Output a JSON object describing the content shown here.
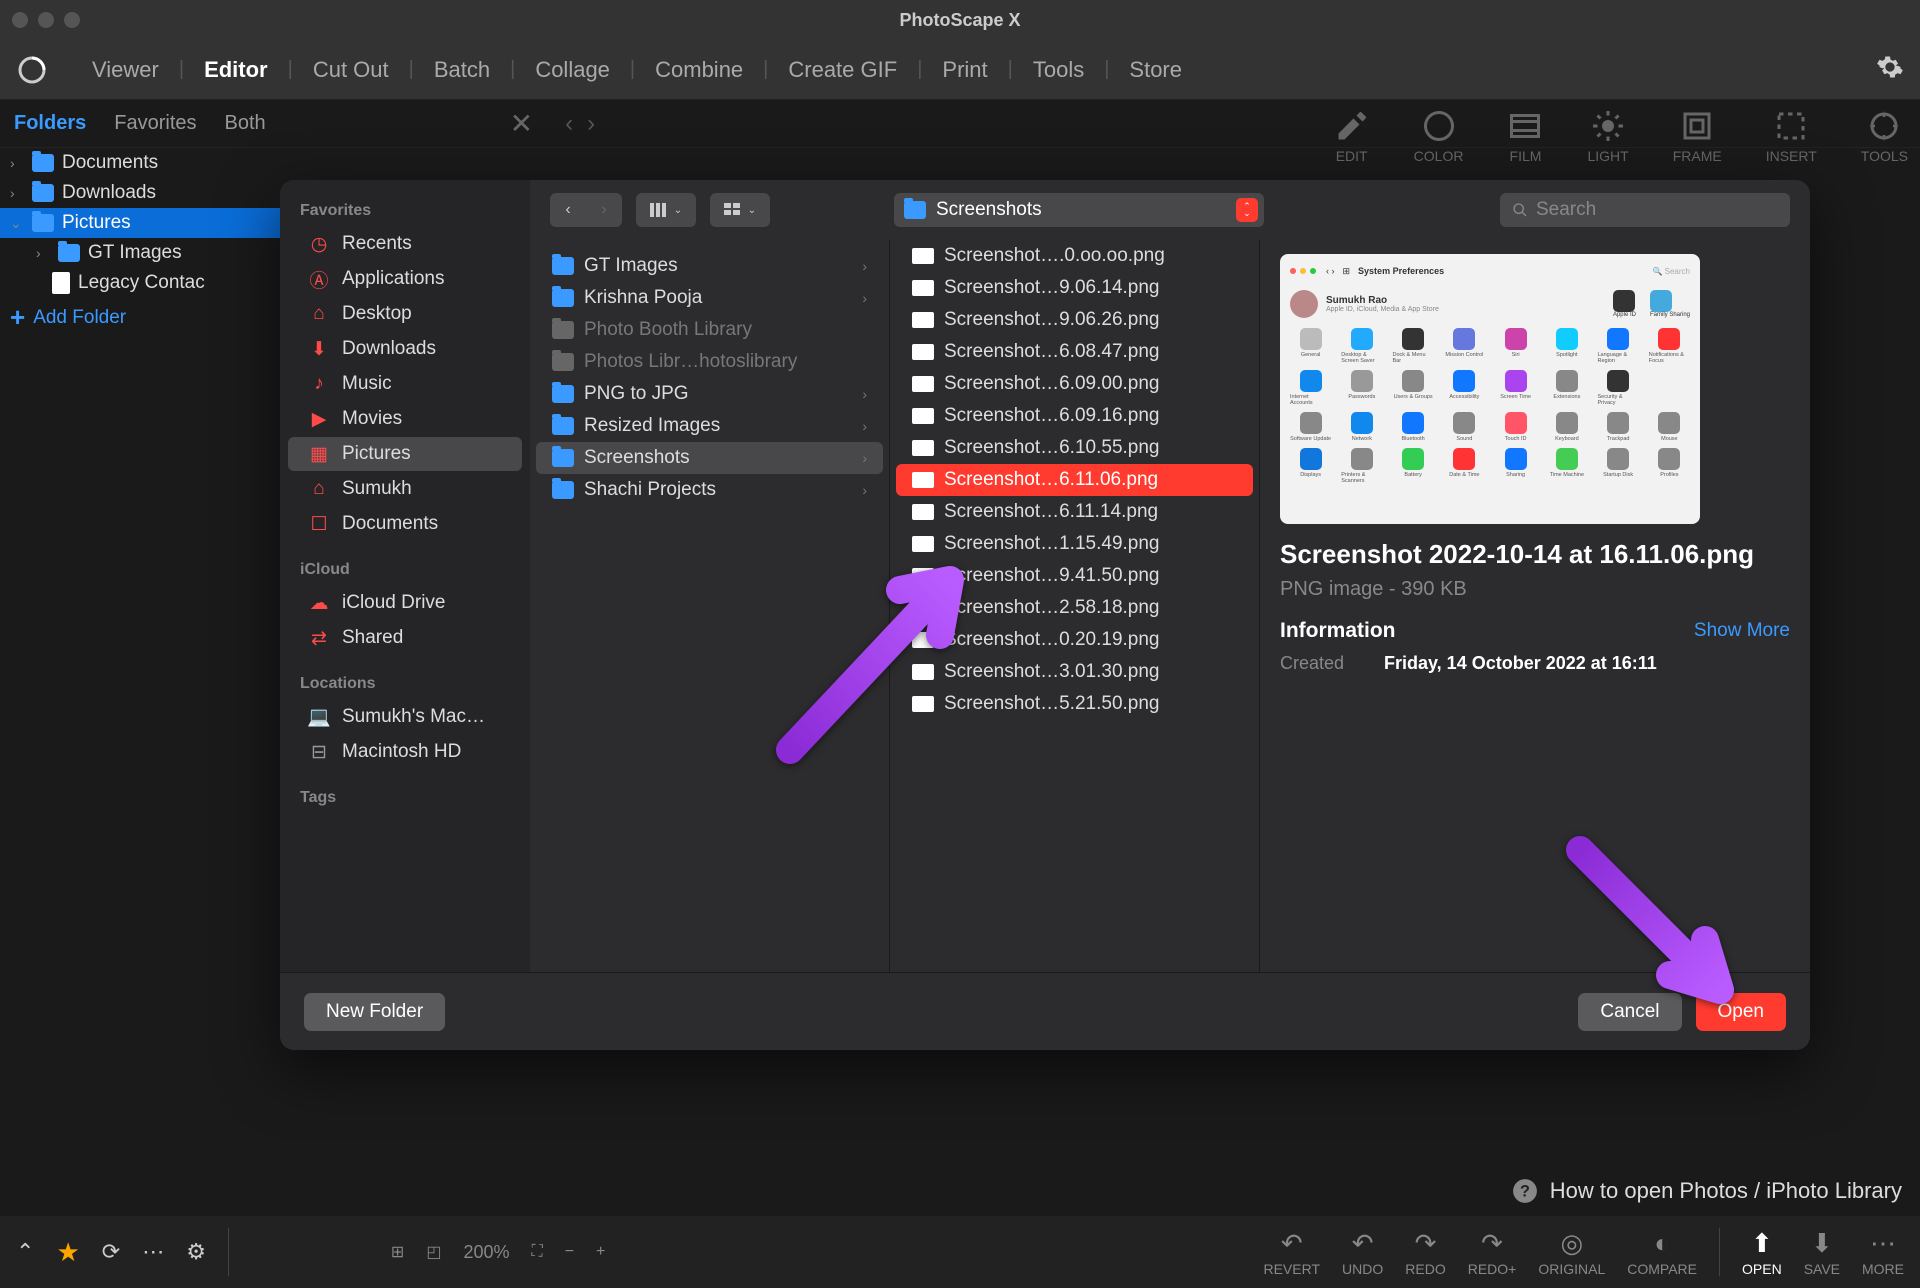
{
  "window": {
    "title": "PhotoScape X"
  },
  "main_tabs": [
    "Viewer",
    "Editor",
    "Cut Out",
    "Batch",
    "Collage",
    "Combine",
    "Create GIF",
    "Print",
    "Tools",
    "Store"
  ],
  "main_tabs_active": "Editor",
  "sec_tabs": [
    "Folders",
    "Favorites",
    "Both"
  ],
  "sec_tabs_active": "Folders",
  "tree": {
    "items": [
      {
        "label": "Documents",
        "indent": 0
      },
      {
        "label": "Downloads",
        "indent": 0
      },
      {
        "label": "Pictures",
        "indent": 0,
        "selected": true,
        "expanded": true
      },
      {
        "label": "GT Images",
        "indent": 1
      },
      {
        "label": "Legacy Contac",
        "indent": 1,
        "file": true
      },
      {
        "label": "Add Folder",
        "indent": 0,
        "add": true
      }
    ]
  },
  "tool_icons": [
    {
      "name": "edit",
      "label": "EDIT"
    },
    {
      "name": "color",
      "label": "COLOR"
    },
    {
      "name": "film",
      "label": "FILM"
    },
    {
      "name": "light",
      "label": "LIGHT"
    },
    {
      "name": "frame",
      "label": "FRAME"
    },
    {
      "name": "insert",
      "label": "INSERT"
    },
    {
      "name": "tools",
      "label": "TOOLS"
    }
  ],
  "dialog": {
    "sidebar": {
      "sections": [
        {
          "heading": "Favorites",
          "items": [
            {
              "icon": "clock",
              "label": "Recents"
            },
            {
              "icon": "apps",
              "label": "Applications"
            },
            {
              "icon": "desktop",
              "label": "Desktop"
            },
            {
              "icon": "download",
              "label": "Downloads"
            },
            {
              "icon": "music",
              "label": "Music"
            },
            {
              "icon": "movie",
              "label": "Movies"
            },
            {
              "icon": "picture",
              "label": "Pictures",
              "selected": true
            },
            {
              "icon": "home",
              "label": "Sumukh"
            },
            {
              "icon": "doc",
              "label": "Documents"
            }
          ]
        },
        {
          "heading": "iCloud",
          "items": [
            {
              "icon": "cloud",
              "label": "iCloud Drive"
            },
            {
              "icon": "shared",
              "label": "Shared"
            }
          ]
        },
        {
          "heading": "Locations",
          "items": [
            {
              "icon": "laptop",
              "label": "Sumukh's Mac…",
              "gray": true
            },
            {
              "icon": "disk",
              "label": "Macintosh HD",
              "gray": true
            }
          ]
        },
        {
          "heading": "Tags",
          "items": []
        }
      ]
    },
    "path_label": "Screenshots",
    "search_placeholder": "Search",
    "column1": [
      {
        "label": "GT Images",
        "type": "folder"
      },
      {
        "label": "Krishna Pooja",
        "type": "folder"
      },
      {
        "label": "Photo Booth Library",
        "type": "lib",
        "disabled": true
      },
      {
        "label": "Photos Libr…hotoslibrary",
        "type": "lib",
        "disabled": true
      },
      {
        "label": "PNG to JPG",
        "type": "folder"
      },
      {
        "label": "Resized Images",
        "type": "folder"
      },
      {
        "label": "Screenshots",
        "type": "folder",
        "selected": true
      },
      {
        "label": "Shachi Projects",
        "type": "folder"
      }
    ],
    "column2": [
      {
        "label": "Screenshot….0.oo.oo.png"
      },
      {
        "label": "Screenshot…9.06.14.png"
      },
      {
        "label": "Screenshot…9.06.26.png"
      },
      {
        "label": "Screenshot…6.08.47.png"
      },
      {
        "label": "Screenshot…6.09.00.png"
      },
      {
        "label": "Screenshot…6.09.16.png"
      },
      {
        "label": "Screenshot…6.10.55.png"
      },
      {
        "label": "Screenshot…6.11.06.png",
        "selected": true
      },
      {
        "label": "Screenshot…6.11.14.png"
      },
      {
        "label": "Screenshot…1.15.49.png"
      },
      {
        "label": "Screenshot…9.41.50.png"
      },
      {
        "label": "Screenshot…2.58.18.png"
      },
      {
        "label": "Screenshot…0.20.19.png"
      },
      {
        "label": "Screenshot…3.01.30.png"
      },
      {
        "label": "Screenshot…5.21.50.png"
      }
    ],
    "preview": {
      "sp_title": "System Preferences",
      "sp_search": "Search",
      "sp_user": "Sumukh Rao",
      "sp_user_sub": "Apple ID, iCloud, Media & App Store",
      "sp_appleid": "Apple ID",
      "sp_family": "Family Sharing",
      "sp_items": [
        "General",
        "Desktop & Screen Saver",
        "Dock & Menu Bar",
        "Mission Control",
        "Siri",
        "Spotlight",
        "Language & Region",
        "Notifications & Focus",
        "Internet Accounts",
        "Passwords",
        "Users & Groups",
        "Accessibility",
        "Screen Time",
        "Extensions",
        "Security & Privacy",
        "",
        "Software Update",
        "Network",
        "Bluetooth",
        "Sound",
        "Touch ID",
        "Keyboard",
        "Trackpad",
        "Mouse",
        "Displays",
        "Printers & Scanners",
        "Battery",
        "Date & Time",
        "Sharing",
        "Time Machine",
        "Startup Disk",
        "Profiles"
      ],
      "title": "Screenshot 2022-10-14 at 16.11.06.png",
      "subtitle": "PNG image - 390 KB",
      "info_heading": "Information",
      "show_more": "Show More",
      "created_label": "Created",
      "created_value": "Friday, 14 October 2022 at 16:11"
    },
    "buttons": {
      "new_folder": "New Folder",
      "cancel": "Cancel",
      "open": "Open"
    }
  },
  "help": "How to open Photos / iPhoto Library",
  "bottom": {
    "zoom": "200%",
    "items": [
      "REVERT",
      "UNDO",
      "REDO",
      "REDO+",
      "ORIGINAL",
      "COMPARE",
      "OPEN",
      "SAVE",
      "MORE"
    ],
    "open_label": "OPEN"
  }
}
